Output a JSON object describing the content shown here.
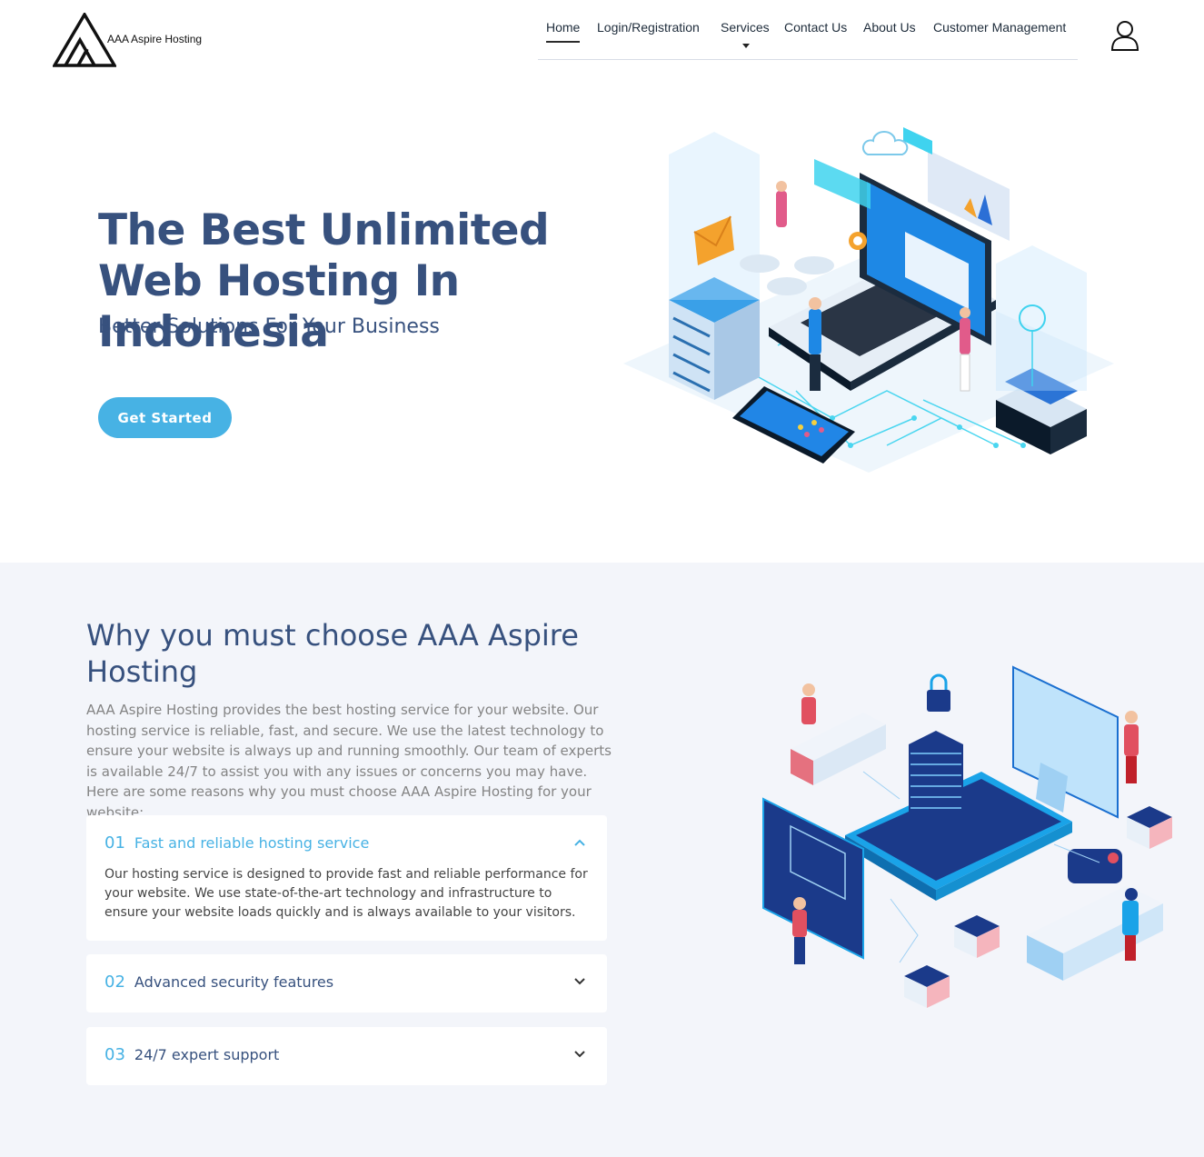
{
  "brand": {
    "name": "AAA Aspire Hosting"
  },
  "nav": {
    "items": [
      {
        "label": "Home",
        "active": true
      },
      {
        "label": "Login/Registration"
      },
      {
        "label": "Services",
        "dropdown": true
      },
      {
        "label": "Contact Us"
      },
      {
        "label": "About Us"
      },
      {
        "label": "Customer Management"
      }
    ],
    "user_icon": "user-icon"
  },
  "hero": {
    "title": "The Best Unlimited Web Hosting In Indonesia",
    "subtitle": "Better Solutions For Your Business",
    "cta_label": "Get Started"
  },
  "why": {
    "title": "Why you must choose AAA Aspire Hosting",
    "description": "AAA Aspire Hosting provides the best hosting service for your website. Our hosting service is reliable, fast, and secure. We use the latest technology to ensure your website is always up and running smoothly. Our team of experts is available 24/7 to assist you with any issues or concerns you may have. Here are some reasons why you must choose AAA Aspire Hosting for your website:",
    "items": [
      {
        "number": "01",
        "label": "Fast and reliable hosting service",
        "open": true,
        "body": "Our hosting service is designed to provide fast and reliable performance for your website. We use state-of-the-art technology and infrastructure to ensure your website loads quickly and is always available to your visitors."
      },
      {
        "number": "02",
        "label": "Advanced security features",
        "open": false
      },
      {
        "number": "03",
        "label": "24/7 expert support",
        "open": false
      }
    ]
  },
  "colors": {
    "accent": "#47b2e4",
    "heading": "#37517e",
    "section_bg": "#f3f5fa"
  }
}
